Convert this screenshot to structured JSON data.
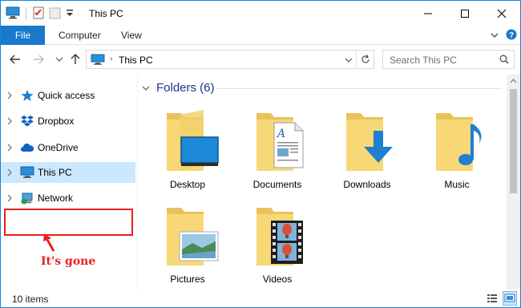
{
  "window": {
    "title": "This PC",
    "accent_color": "#1979ca"
  },
  "quick_access_toolbar": {
    "icons": [
      "computer-icon",
      "properties-icon",
      "new-folder-icon",
      "customize-dropdown-icon"
    ]
  },
  "ribbon": {
    "file_label": "File",
    "tabs": [
      "Computer",
      "View"
    ]
  },
  "address_bar": {
    "path": "This PC",
    "search_placeholder": "Search This PC"
  },
  "nav_pane": {
    "items": [
      {
        "label": "Quick access",
        "icon": "star-icon",
        "selected": false
      },
      {
        "label": "Dropbox",
        "icon": "dropbox-icon",
        "selected": false
      },
      {
        "label": "OneDrive",
        "icon": "cloud-icon",
        "selected": false
      },
      {
        "label": "This PC",
        "icon": "monitor-icon",
        "selected": true
      },
      {
        "label": "Network",
        "icon": "network-icon",
        "selected": false
      }
    ],
    "annotation": "It's gone",
    "annotation_color": "#e8201e"
  },
  "content": {
    "group_title": "Folders (6)",
    "folders": [
      {
        "label": "Desktop",
        "overlay": "desktop-overlay-icon"
      },
      {
        "label": "Documents",
        "overlay": "document-overlay-icon"
      },
      {
        "label": "Downloads",
        "overlay": "download-arrow-icon"
      },
      {
        "label": "Music",
        "overlay": "music-note-icon"
      },
      {
        "label": "Pictures",
        "overlay": "picture-overlay-icon"
      },
      {
        "label": "Videos",
        "overlay": "film-strip-icon"
      }
    ]
  },
  "status_bar": {
    "item_count": "10 items"
  }
}
